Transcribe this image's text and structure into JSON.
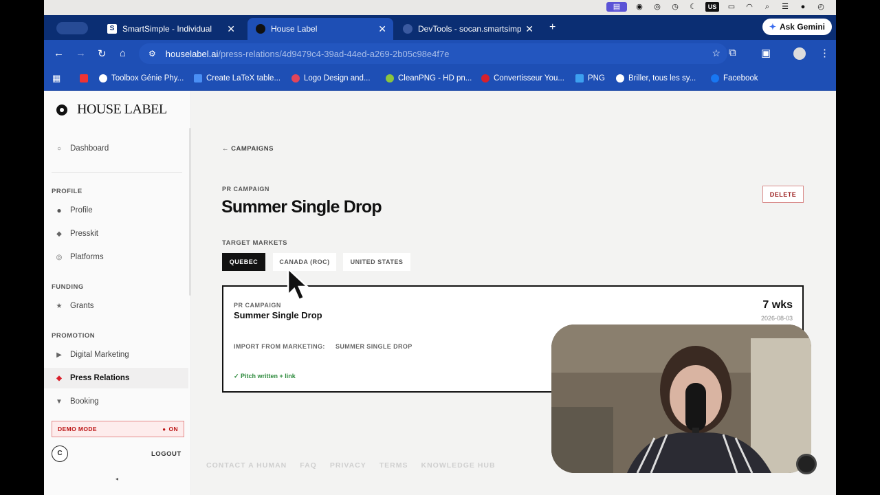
{
  "tabs": [
    {
      "title": "SmartSimple - Individual",
      "icon": "S"
    },
    {
      "title": "House Label",
      "icon": "hl"
    },
    {
      "title": "DevTools - socan.smartsimpl",
      "icon": "devtools"
    }
  ],
  "gemini_label": "Ask Gemini",
  "url": {
    "host": "houselabel.ai",
    "path": "/press-relations/4d9479c4-39ad-44ed-a269-2b05c98e4f7e"
  },
  "bookmarks": [
    "Toolbox Génie Phy...",
    "Create LaTeX table...",
    "Logo Design and...",
    "CleanPNG - HD pn...",
    "Convertisseur You...",
    "PNG",
    "Briller, tous les sy...",
    "Facebook"
  ],
  "mac_status": {
    "keyboard": "US"
  },
  "brand": "HOUSE LABEL",
  "sidebar": {
    "dashboard": "Dashboard",
    "profile_section": "PROFILE",
    "profile": "Profile",
    "presskit": "Presskit",
    "platforms": "Platforms",
    "funding_section": "FUNDING",
    "grants": "Grants",
    "promotion_section": "PROMOTION",
    "digital_marketing": "Digital Marketing",
    "press_relations": "Press Relations",
    "booking": "Booking",
    "demo_mode": "DEMO MODE",
    "demo_state": "ON",
    "avatar": "C",
    "logout": "LOGOUT"
  },
  "main": {
    "back": "← CAMPAIGNS",
    "eyebrow": "PR CAMPAIGN",
    "title": "Summer Single Drop",
    "delete": "DELETE",
    "target_markets_label": "TARGET MARKETS",
    "markets": [
      {
        "label": "QUEBEC",
        "selected": true
      },
      {
        "label": "CANADA (ROC)",
        "selected": false
      },
      {
        "label": "UNITED STATES",
        "selected": false
      }
    ],
    "card": {
      "kicker": "PR CAMPAIGN",
      "name": "Summer Single Drop",
      "duration": "7 wks",
      "date": "2026-08-03",
      "import_label": "IMPORT FROM MARKETING:",
      "import_value": "SUMMER SINGLE DROP",
      "pitch": "✓ Pitch written + link"
    },
    "footer": [
      "CONTACT A HUMAN",
      "FAQ",
      "PRIVACY",
      "TERMS",
      "KNOWLEDGE HUB"
    ]
  },
  "colors": {
    "accent": "#d91e2a",
    "chrome": "#1e4fb5",
    "chrome_dark": "#0b2e73"
  }
}
